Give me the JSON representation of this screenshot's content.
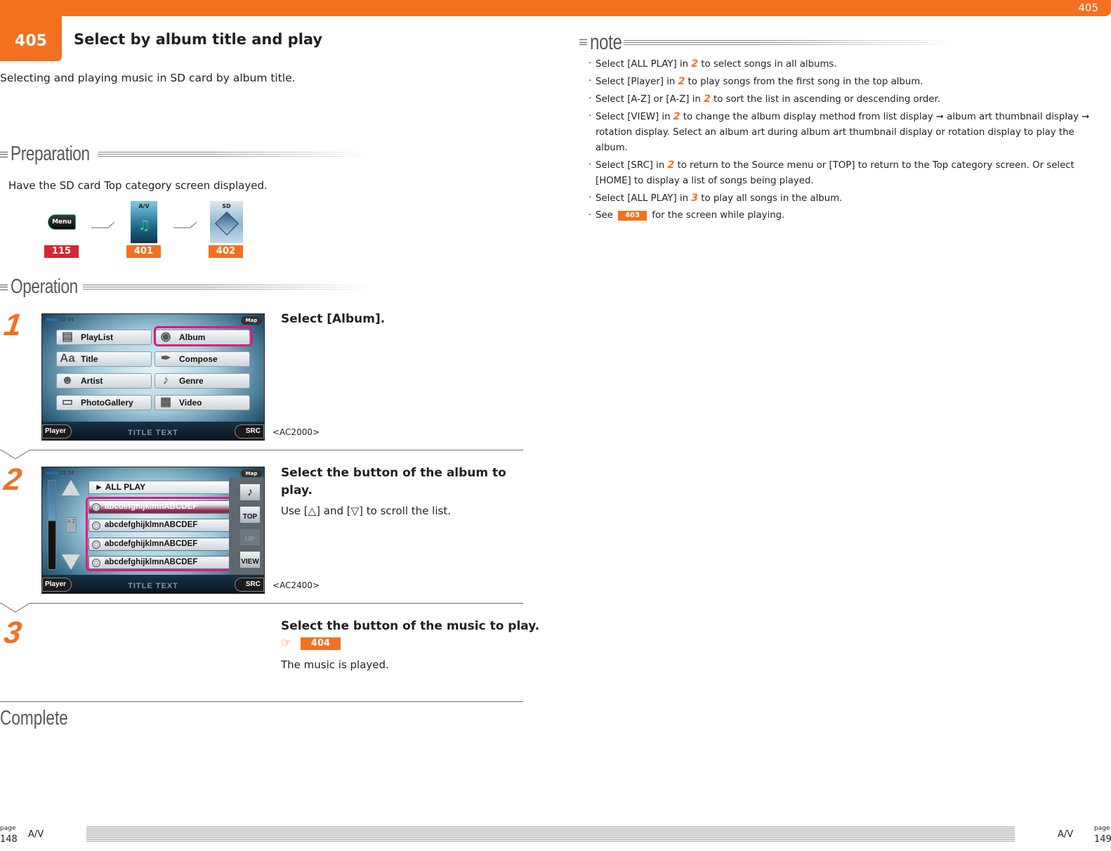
{
  "header": {
    "page_number": "405",
    "section_badge": "405",
    "title": "Select by album title and play",
    "description": "Selecting and playing music in SD card by album title."
  },
  "preparation": {
    "heading": "Preparation",
    "text": "Have the SD card Top category screen displayed.",
    "flow": [
      {
        "icon": "menu-button-icon",
        "label": "Menu",
        "ref": "115",
        "ref_color": "#d7262f"
      },
      {
        "icon": "av-tile-icon",
        "label": "A/V",
        "ref": "401",
        "ref_color": "#f37021"
      },
      {
        "icon": "sd-tile-icon",
        "label": "SD",
        "ref": "402",
        "ref_color": "#f37021"
      }
    ]
  },
  "operation": {
    "heading": "Operation",
    "steps": [
      {
        "number": "1",
        "title": "Select [Album].",
        "text": "",
        "code": "<AC2000>",
        "screen": {
          "clock": "12:34",
          "map": "Map",
          "buttons": [
            "PlayList",
            "Album",
            "Title",
            "Compose",
            "Artist",
            "Genre",
            "PhotoGallery",
            "Video"
          ],
          "highlighted": "Album",
          "player": "Player",
          "src": "SRC",
          "title_text": "TITLE TEXT"
        }
      },
      {
        "number": "2",
        "title": "Select the button of the album to play.",
        "text": "Use [△] and [▽] to scroll the list.",
        "code": "<AC2400>",
        "screen": {
          "clock": "12:34",
          "map": "Map",
          "all_play": "► ALL PLAY",
          "items": [
            "abcdefghijklmnABCDEF",
            "abcdefghijklmnABCDEF",
            "abcdefghijklmnABCDEF",
            "abcdefghijklmnABCDEF"
          ],
          "az": "A Z",
          "side_buttons": [
            "♪",
            "TOP",
            "UP",
            "VIEW"
          ],
          "player": "Player",
          "src": "SRC",
          "title_text": "TITLE TEXT"
        }
      },
      {
        "number": "3",
        "title": "Select the button of the music to play.",
        "ref": "404",
        "text": "The music is played."
      }
    ],
    "complete": "Complete"
  },
  "note": {
    "heading": "note",
    "items": [
      {
        "pre": "Select [ALL PLAY] in ",
        "step": "2",
        "post": " to select songs in all albums."
      },
      {
        "pre": "Select [Player] in ",
        "step": "2",
        "post": " to play songs from the first song in the top album."
      },
      {
        "pre": "Select [A-Z] or [A-Z] in ",
        "step": "2",
        "post": " to sort the list in ascending or descending order."
      },
      {
        "pre": "Select [VIEW] in ",
        "step": "2",
        "post": " to change the album display method from list display ➞ album art thumbnail display ➞ rotation display. Select an album art during album art thumbnail display or rotation display to play the album."
      },
      {
        "pre": "Select [SRC] in ",
        "step": "2",
        "post": " to return to the Source menu or [TOP] to return to the Top category screen. Or select [HOME] to display a list of songs being played."
      },
      {
        "pre": "Select [ALL PLAY] in ",
        "step": "3",
        "post": " to play all songs in the album."
      },
      {
        "pre": "See ",
        "badge": "403",
        "post": " for the screen while playing."
      }
    ]
  },
  "footer": {
    "left": {
      "page_label": "page",
      "page_number": "148",
      "section": "A/V"
    },
    "right": {
      "page_label": "page",
      "page_number": "149",
      "section": "A/V"
    }
  },
  "colors": {
    "accent": "#f37021",
    "ref_red": "#d7262f",
    "highlight": "#e5177e"
  }
}
